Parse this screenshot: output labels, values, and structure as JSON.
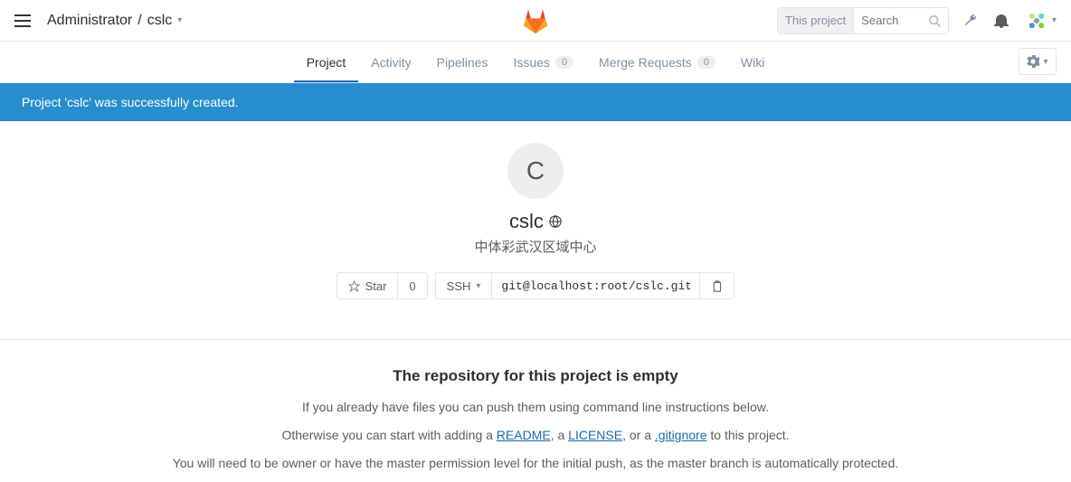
{
  "header": {
    "breadcrumb_owner": "Administrator",
    "breadcrumb_sep": "/",
    "breadcrumb_project": "cslc",
    "search_scope": "This project",
    "search_placeholder": "Search"
  },
  "tabs": {
    "project": "Project",
    "activity": "Activity",
    "pipelines": "Pipelines",
    "issues": "Issues",
    "issues_badge": "0",
    "merge_requests": "Merge Requests",
    "mr_badge": "0",
    "wiki": "Wiki"
  },
  "flash": "Project 'cslc' was successfully created.",
  "project": {
    "initial": "C",
    "name": "cslc",
    "description": "中体彩武汉区域中心",
    "star_label": "Star",
    "star_count": "0",
    "clone_proto": "SSH",
    "clone_url": "git@localhost:root/cslc.git"
  },
  "empty": {
    "heading": "The repository for this project is empty",
    "line1": "If you already have files you can push them using command line instructions below.",
    "line2_prefix": "Otherwise you can start with adding a ",
    "readme": "README",
    "sep1": ", a ",
    "license": "LICENSE",
    "sep2": ", or a ",
    "gitignore": ".gitignore",
    "line2_suffix": " to this project.",
    "line3": "You will need to be owner or have the master permission level for the initial push, as the master branch is automatically protected."
  }
}
